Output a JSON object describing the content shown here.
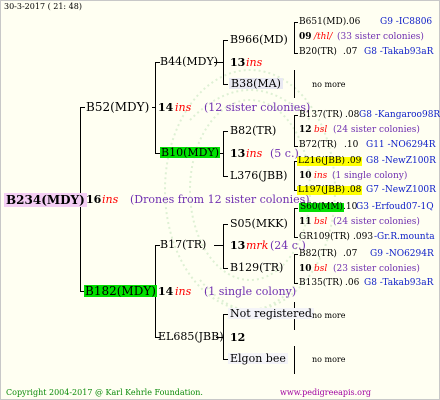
{
  "header": {
    "date": "30-3-2017 ( 21: 48)"
  },
  "footer": {
    "copyright": "Copyright 2004-2017 @ Karl Kehrle Foundation.",
    "site": "www.pedigreeapis.org"
  },
  "root": {
    "name": "B234(MDY)",
    "num": "16",
    "ins": "ins",
    "note": "(Drones from 12 sister colonies)"
  },
  "dam": {
    "name": "B52(MDY)",
    "num": "14",
    "ins": "ins",
    "note": "(12 sister colonies)"
  },
  "sire": {
    "name": "B182(MDY)",
    "num": "14",
    "ins": "ins",
    "note": "(1 single colony)"
  },
  "b44": {
    "name": "B44(MDY)",
    "num": "13",
    "ins": "ins"
  },
  "b10": {
    "name": "B10(MDY)",
    "num": "13",
    "ins": "ins",
    "note": "(5 c.)"
  },
  "b17": {
    "name": "B17(TR)",
    "num": "13",
    "ins": "mrk",
    "note": "(24 c.)"
  },
  "el685": {
    "name": "EL685(JBB)",
    "num": "12"
  },
  "b966": {
    "name": "B966(MD)",
    "num": "09",
    "ins": "/thl/",
    "note": "(33 sister colonies)"
  },
  "b38": {
    "name": "B38(MA)",
    "more": "no more"
  },
  "b82a": {
    "name": "B82(TR)",
    "num": "12",
    "ins": "bsl",
    "note": "(24 sister colonies)"
  },
  "l376": {
    "name": "L376(JBB)",
    "num": "10",
    "ins": "ins",
    "note": "(1 single colony)"
  },
  "s05": {
    "name": "S05(MKK)",
    "num": "11",
    "ins": "bsl",
    "note": "(24 sister colonies)"
  },
  "b129": {
    "name": "B129(TR)",
    "num": "10",
    "ins": "bsl",
    "note": "(23 sister colonies)"
  },
  "notreg": {
    "name": "Not registered",
    "more": "no more"
  },
  "elgon": {
    "name": "Elgon bee",
    "more": "no more"
  },
  "g1": {
    "name": "B651(MD)",
    "yr": ".06",
    "code": "G9 -IC8806"
  },
  "g2": {
    "name": "B20(TR)",
    "yr": ".07",
    "code": "G8 -Takab93aR"
  },
  "g3": {
    "name": "B137(TR)",
    "yr": ".08",
    "code": "G8 -Kangaroo98R"
  },
  "g4": {
    "name": "B72(TR)",
    "yr": ".10",
    "code": "G11 -NO6294R"
  },
  "g5": {
    "name": "L216(JBB)",
    "yr": ".09",
    "code": "G8 -NewZ100R"
  },
  "g6": {
    "name": "L197(JBB)",
    "yr": ".08",
    "code": "G7 -NewZ100R"
  },
  "g7": {
    "name": "S60(MM)",
    "yr": ".10",
    "code": "G3 -Erfoud07-1Q"
  },
  "g8": {
    "name": "GR109(TR)",
    "yr": ".093",
    "code": "-Gr.R.mounta"
  },
  "g9": {
    "name": "B82(TR)",
    "yr": ".07",
    "code": "G9 -NO6294R"
  },
  "g10": {
    "name": "B135(TR)",
    "yr": ".06",
    "code": "G8 -Takab93aR"
  },
  "colors": {
    "highlight_green": "#00e000",
    "highlight_yellow": "#ffff00",
    "root_pink": "#f4cef4",
    "ins_red": "#ff0000",
    "code_blue": "#1020c8"
  }
}
